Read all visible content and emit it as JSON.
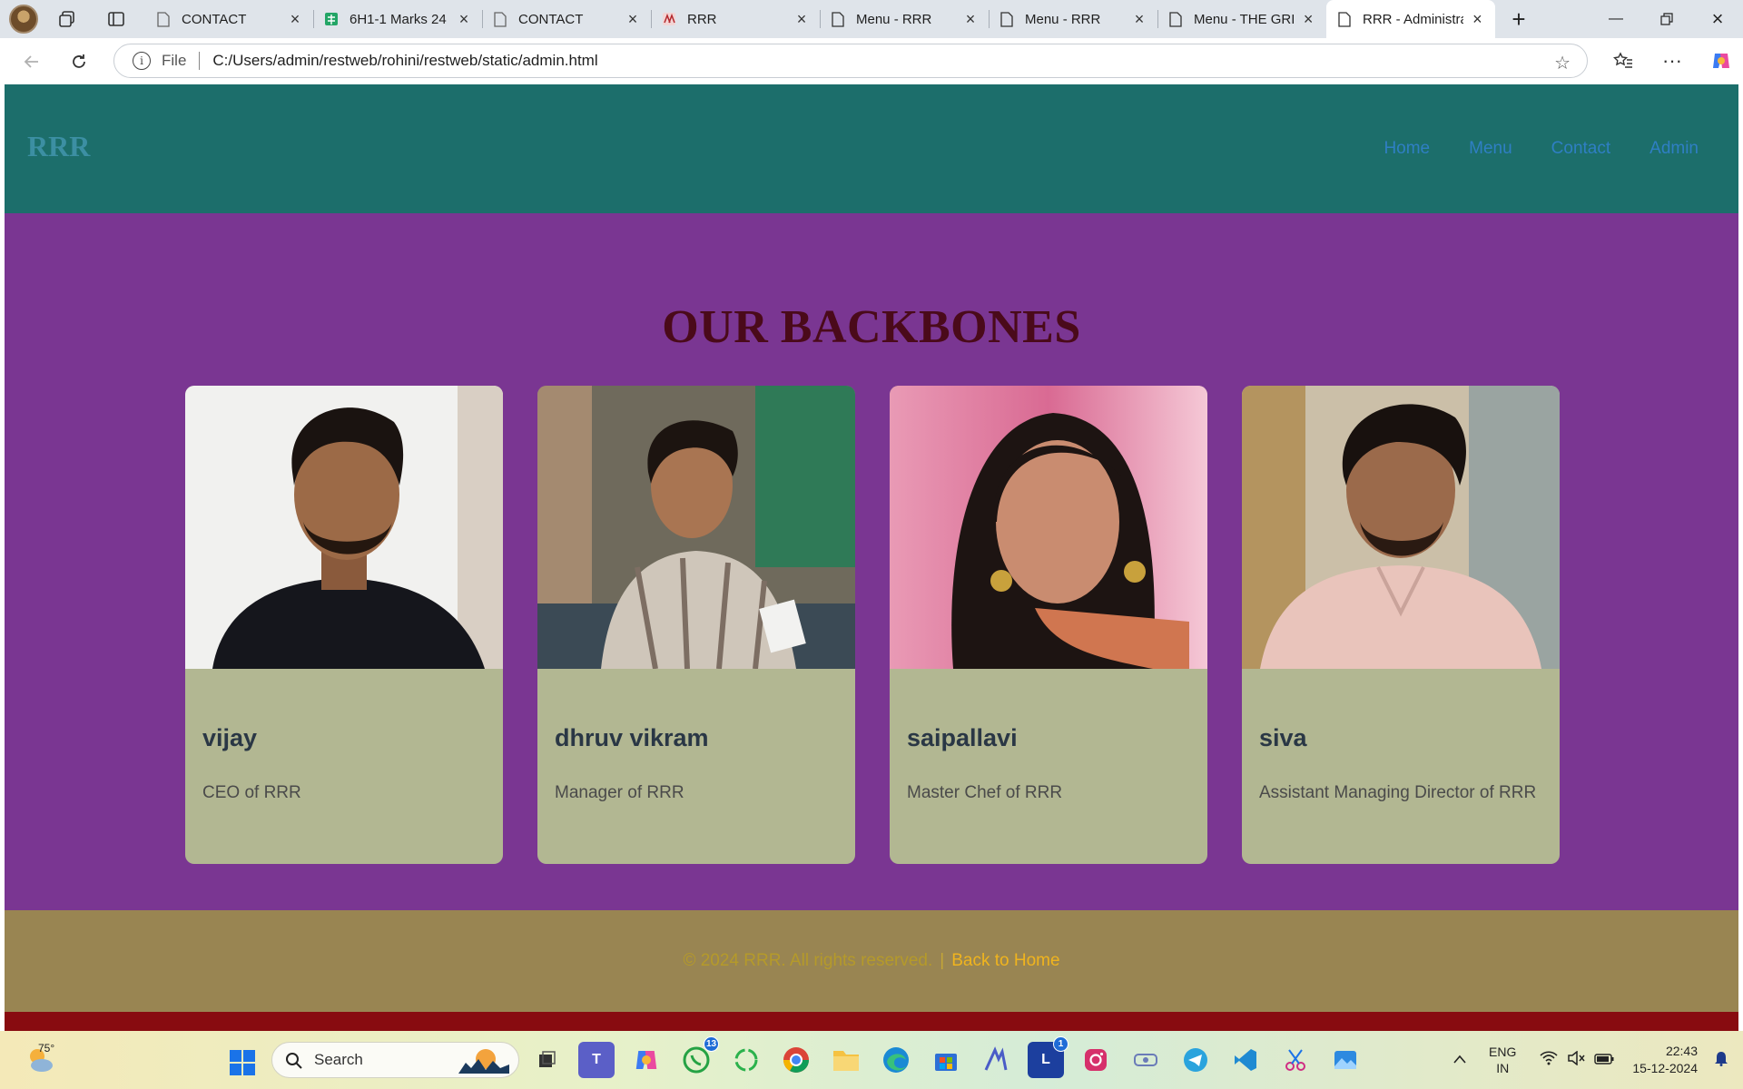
{
  "browser": {
    "tabs": [
      {
        "label": "CONTACT",
        "icon": "page-icon",
        "active": false
      },
      {
        "label": "6H1-1 Marks 24",
        "icon": "sheets-icon",
        "active": false
      },
      {
        "label": "CONTACT",
        "icon": "page-icon",
        "active": false
      },
      {
        "label": "RRR",
        "icon": "rrr-favicon",
        "active": false
      },
      {
        "label": "Menu - RRR",
        "icon": "page-icon",
        "active": false
      },
      {
        "label": "Menu - RRR",
        "icon": "page-icon",
        "active": false
      },
      {
        "label": "Menu - THE GRI",
        "icon": "page-icon",
        "active": false
      },
      {
        "label": "RRR - Administra",
        "icon": "page-icon",
        "active": true
      }
    ],
    "address": {
      "scheme_label": "File",
      "url": "C:/Users/admin/restweb/rohini/restweb/static/admin.html"
    }
  },
  "site": {
    "logo": "RRR",
    "nav": [
      "Home",
      "Menu",
      "Contact",
      "Admin"
    ],
    "section_title": "OUR BACKBONES",
    "team": [
      {
        "name": "vijay",
        "role": "CEO of RRR"
      },
      {
        "name": "dhruv vikram",
        "role": "Manager of RRR"
      },
      {
        "name": "saipallavi",
        "role": "Master Chef of RRR"
      },
      {
        "name": "siva",
        "role": "Assistant Managing Director of RRR"
      }
    ],
    "footer": {
      "copyright": "© 2024 RRR. All rights reserved.",
      "separator": "|",
      "link": "Back to Home"
    }
  },
  "taskbar": {
    "weather_temp": "75°",
    "search_placeholder": "Search",
    "whatsapp_badge": "13",
    "l_badge": "1",
    "lang_line1": "ENG",
    "lang_line2": "IN",
    "time": "22:43",
    "date": "15-12-2024"
  },
  "colors": {
    "header": "#1c6e6b",
    "page_bg": "#7a3692",
    "card_bg": "#b2b792",
    "footer": "#998552",
    "footer_band": "#880b10",
    "title": "#4a0a1a"
  }
}
